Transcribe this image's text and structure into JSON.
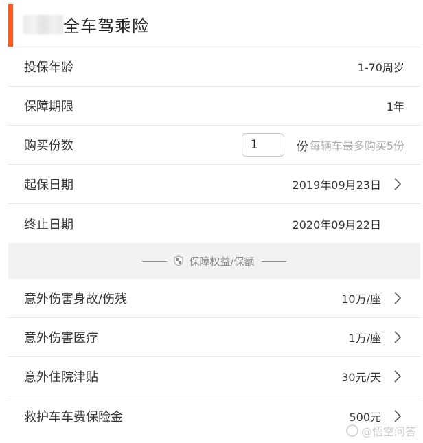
{
  "header": {
    "title": "全车驾乘险"
  },
  "rows_top": [
    {
      "label": "投保年龄",
      "value": "1-70周岁"
    },
    {
      "label": "保障期限",
      "value": "1年"
    }
  ],
  "quantity": {
    "label": "购买份数",
    "value": "1",
    "unit": "份",
    "hint": "每辆车最多购买5份"
  },
  "dates": [
    {
      "label": "起保日期",
      "value": "2019年09月23日",
      "has_chevron": true
    },
    {
      "label": "终止日期",
      "value": "2020年09月22日",
      "has_chevron": false
    }
  ],
  "section": {
    "title": "保障权益/保额"
  },
  "benefits": [
    {
      "label": "意外伤害身故/伤残",
      "value": "10万/座"
    },
    {
      "label": "意外伤害医疗",
      "value": "1万/座"
    },
    {
      "label": "意外住院津贴",
      "value": "30元/天"
    },
    {
      "label": "救护车车费保险金",
      "value": "500元"
    }
  ],
  "watermark": {
    "text": "@悟空问答"
  },
  "colors": {
    "accent": "#ff5a1f",
    "divider_bg": "#f2f2f2",
    "hint": "#aaaaaa"
  }
}
